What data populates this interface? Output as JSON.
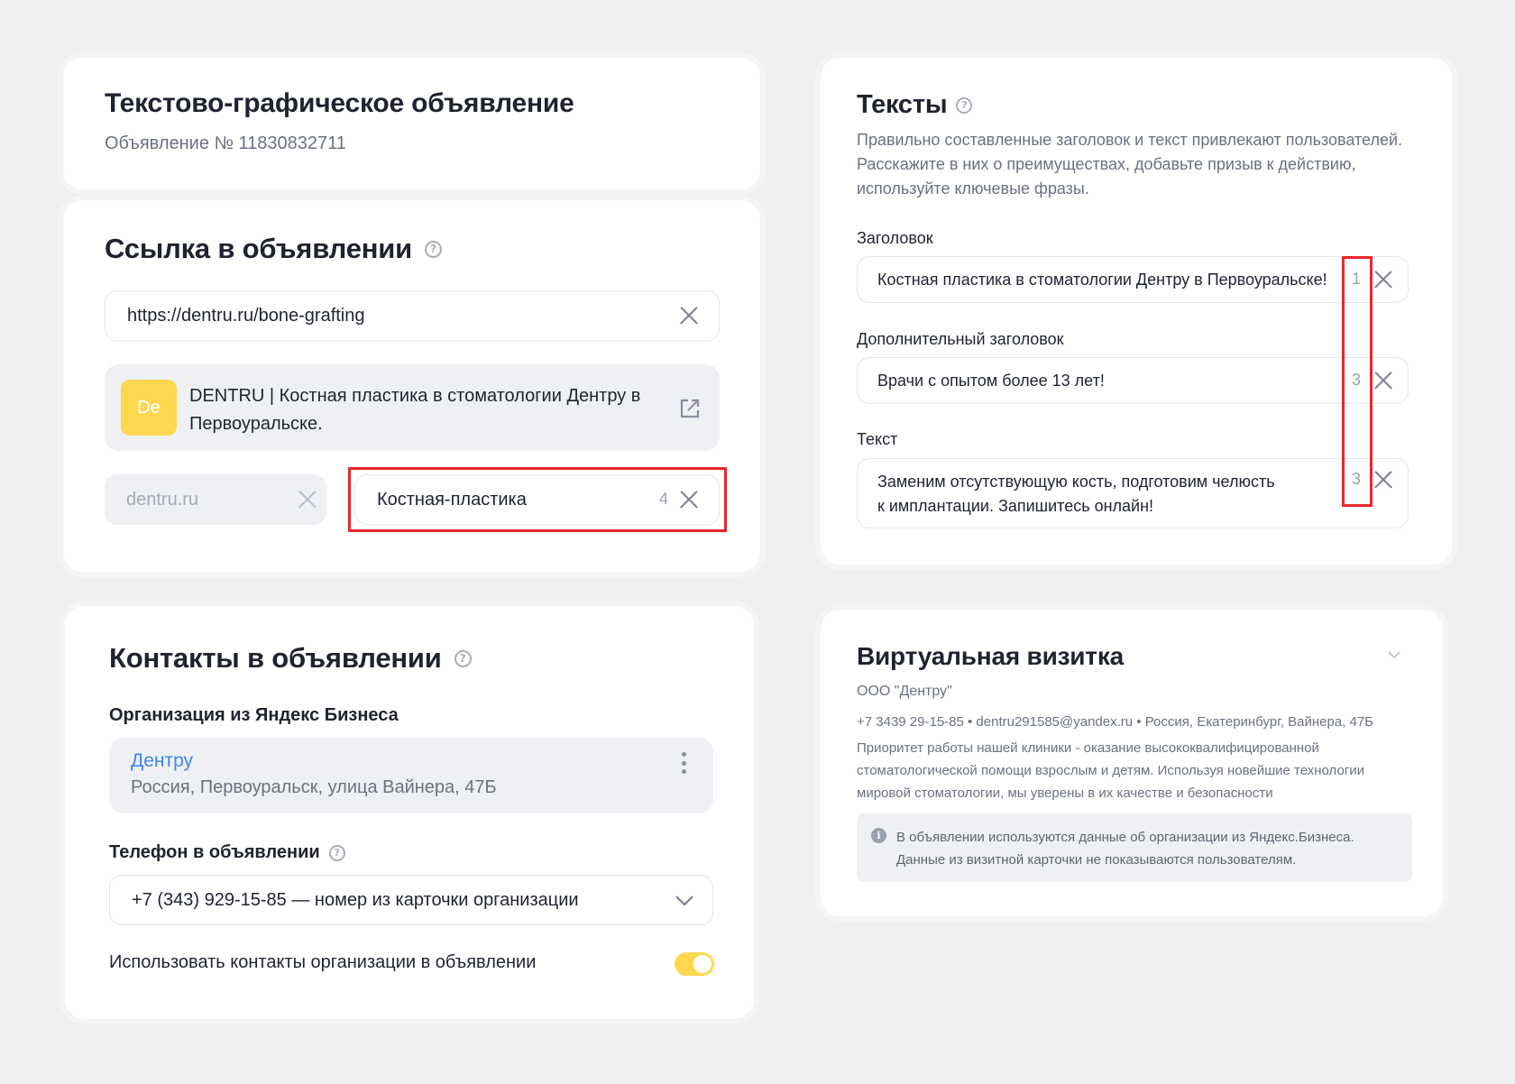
{
  "ad_header": {
    "title": "Текстово-графическое объявление",
    "number": "Объявление № 11830832711"
  },
  "link_section": {
    "title": "Ссылка в объявлении",
    "url_value": "https://dentru.ru/bone-grafting",
    "preview_avatar": "De",
    "preview_text": "DENTRU | Костная пластика в стоматологии Дентру в Первоуральске.",
    "display_domain": "dentru.ru",
    "display_path": "Костная-пластика",
    "display_path_counter": "4"
  },
  "texts_section": {
    "title": "Тексты",
    "description": "Правильно составленные заголовок и текст привлекают пользователей. Расскажите в них о преимуществах, добавьте призыв к действию, используйте ключевые фразы.",
    "headline_label": "Заголовок",
    "headline_value": "Костная пластика в стоматологии Дентру в Первоуральске!",
    "headline_counter": "1",
    "extra_headline_label": "Дополнительный заголовок",
    "extra_headline_value": "Врачи с опытом более 13 лет!",
    "extra_headline_counter": "3",
    "text_label": "Текст",
    "text_value_line1": "Заменим отсутствующую кость, подготовим челюсть",
    "text_value_line2": "к имплантации. Запишитесь онлайн!",
    "text_counter": "3"
  },
  "contacts_section": {
    "title": "Контакты в объявлении",
    "org_label": "Организация из Яндекс Бизнеса",
    "org_name": "Дентру",
    "org_address": "Россия, Первоуральск, улица Вайнера, 47Б",
    "phone_label": "Телефон в объявлении",
    "phone_value": "+7 (343) 929-15-85 — номер из карточки организации",
    "use_contacts_label": "Использовать контакты организации в объявлении",
    "use_contacts_enabled": true
  },
  "vcard_section": {
    "title": "Виртуальная визитка",
    "company": "ООО \"Дентру\"",
    "contacts_line": "+7 3439 29-15-85  • dentru291585@yandex.ru • Россия, Екатеринбург, Вайнера, 47Б",
    "description_line1": "Приоритет работы нашей клиники - оказание высококвалифицированной",
    "description_line2": "стоматологической помощи взрослым и детям. Используя новейшие технологии",
    "description_line3": "мировой стоматологии, мы уверены в их качестве и безопасности",
    "notice_line1": "В объявлении используются данные об организации из Яндекс.Бизнеса.",
    "notice_line2": "Данные из визитной карточки не показываются пользователям."
  },
  "colors": {
    "accent_yellow": "#fdd84f",
    "link_blue": "#3f85f5",
    "highlight_red": "#e8272a"
  }
}
